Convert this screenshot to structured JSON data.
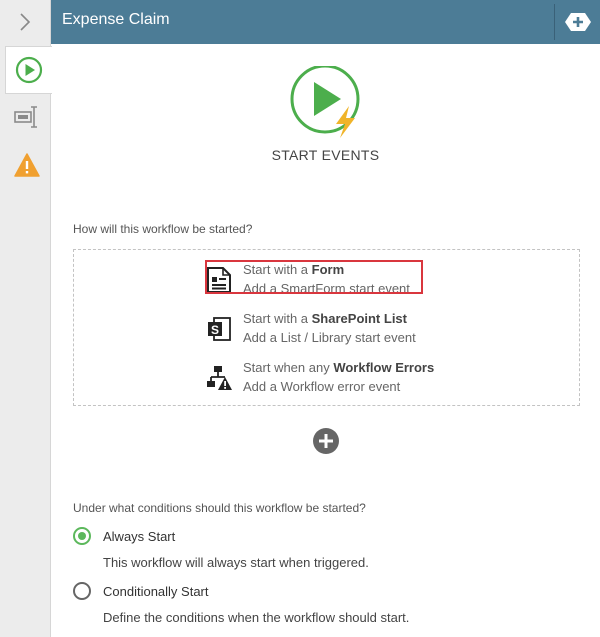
{
  "header": {
    "title": "Expense Claim"
  },
  "sidebar": {
    "tabs": [
      {
        "icon": "play-icon",
        "active": true
      },
      {
        "icon": "textfield-icon",
        "active": false
      },
      {
        "icon": "warning-icon",
        "active": false
      }
    ]
  },
  "hero": {
    "label": "START EVENTS"
  },
  "start_question": "How will this workflow be started?",
  "options": [
    {
      "icon": "form-icon",
      "prefix": "Start with a ",
      "bold": "Form",
      "subtitle": "Add a SmartForm start event"
    },
    {
      "icon": "sharepoint-icon",
      "prefix": "Start with a ",
      "bold": "SharePoint List",
      "subtitle": "Add a List / Library start event"
    },
    {
      "icon": "workflow-error-icon",
      "prefix": "Start when any ",
      "bold": "Workflow Errors",
      "subtitle": "Add a Workflow error event"
    }
  ],
  "conditions_question": "Under what conditions should this workflow be started?",
  "conditions": [
    {
      "label": "Always Start",
      "description": "This workflow will always start when triggered.",
      "selected": true
    },
    {
      "label": "Conditionally Start",
      "description": "Define the conditions when the workflow should start.",
      "selected": false
    }
  ],
  "colors": {
    "header": "#4c7c96",
    "accent_green": "#5cb85c",
    "bolt": "#f0b429",
    "highlight": "#d9363e",
    "warning": "#f0a030"
  }
}
